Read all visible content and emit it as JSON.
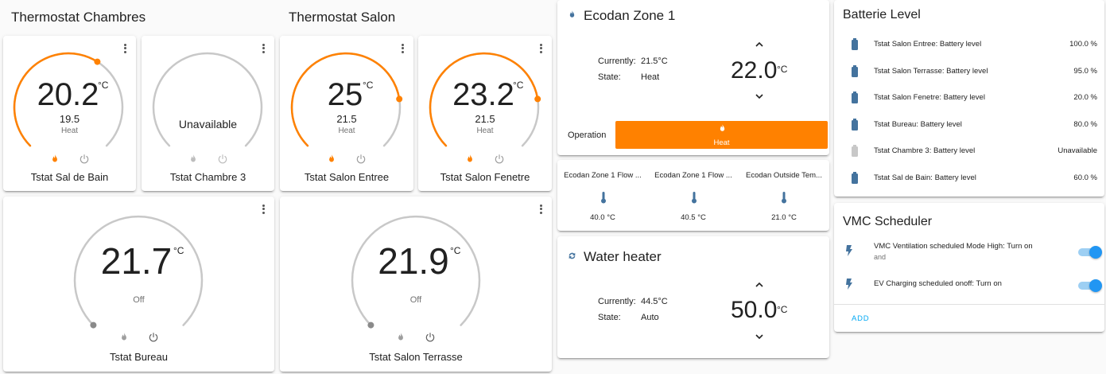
{
  "colors": {
    "heat": "#ff8100",
    "idle": "#c8c8c8",
    "blue": "#44739e",
    "accent": "#03a9f4",
    "toggle": "#2196f3"
  },
  "sections": {
    "chambres_title": "Thermostat Chambres",
    "salon_title": "Thermostat Salon"
  },
  "thermostats": {
    "sal_de_bain": {
      "name": "Tstat Sal de Bain",
      "target": "20.2",
      "unit": "°C",
      "current": "19.5",
      "mode": "Heat",
      "level": 0.62
    },
    "chambre3": {
      "name": "Tstat Chambre 3",
      "status": "Unavailable"
    },
    "salon_entree": {
      "name": "Tstat Salon Entree",
      "target": "25",
      "unit": "°C",
      "current": "21.5",
      "mode": "Heat",
      "level": 0.8
    },
    "salon_fenetre": {
      "name": "Tstat Salon Fenetre",
      "target": "23.2",
      "unit": "°C",
      "current": "21.5",
      "mode": "Heat",
      "level": 0.8
    },
    "bureau": {
      "name": "Tstat Bureau",
      "target": "21.7",
      "unit": "°C",
      "mode": "Off"
    },
    "salon_terrasse": {
      "name": "Tstat Salon Terrasse",
      "target": "21.9",
      "unit": "°C",
      "mode": "Off"
    }
  },
  "ecodan": {
    "title": "Ecodan Zone 1",
    "currently_label": "Currently:",
    "currently_value": "21.5°C",
    "state_label": "State:",
    "state_value": "Heat",
    "target": "22.0",
    "unit": "°C",
    "operation_label": "Operation",
    "operation_value": "Heat"
  },
  "sensors": [
    {
      "name": "Ecodan Zone 1 Flow ...",
      "value": "40.0 °C"
    },
    {
      "name": "Ecodan Zone 1 Flow ...",
      "value": "40.5 °C"
    },
    {
      "name": "Ecodan Outside Tem...",
      "value": "21.0 °C"
    }
  ],
  "water_heater": {
    "title": "Water heater",
    "currently_label": "Currently:",
    "currently_value": "44.5°C",
    "state_label": "State:",
    "state_value": "Auto",
    "target": "50.0",
    "unit": "°C"
  },
  "battery": {
    "title": "Batterie Level",
    "items": [
      {
        "label": "Tstat Salon Entree: Battery level",
        "value": "100.0 %",
        "available": true
      },
      {
        "label": "Tstat Salon Terrasse: Battery level",
        "value": "95.0 %",
        "available": true
      },
      {
        "label": "Tstat Salon Fenetre: Battery level",
        "value": "20.0 %",
        "available": true
      },
      {
        "label": "Tstat Bureau: Battery level",
        "value": "80.0 %",
        "available": true
      },
      {
        "label": "Tstat Chambre 3: Battery level",
        "value": "Unavailable",
        "available": false
      },
      {
        "label": "Tstat Sal de Bain: Battery level",
        "value": "60.0 %",
        "available": true
      }
    ]
  },
  "vmc": {
    "title": "VMC Scheduler",
    "items": [
      {
        "label": "VMC Ventilation scheduled Mode High: Turn on",
        "sub": "and",
        "on": true
      },
      {
        "label": "EV Charging scheduled onoff: Turn on",
        "sub": "",
        "on": true
      }
    ],
    "add_label": "ADD"
  }
}
